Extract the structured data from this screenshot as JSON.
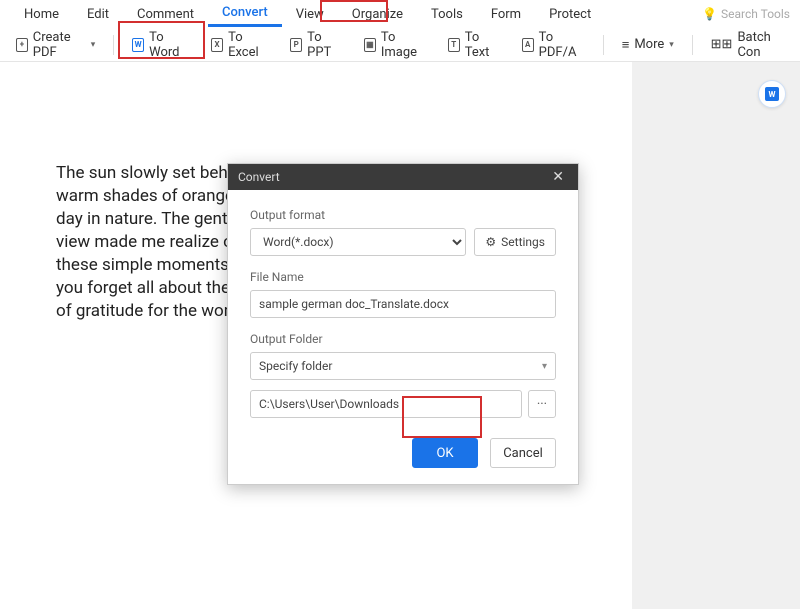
{
  "tabs": {
    "home": "Home",
    "edit": "Edit",
    "comment": "Comment",
    "convert": "Convert",
    "view": "View",
    "organize": "Organize",
    "tools": "Tools",
    "form": "Form",
    "protect": "Protect"
  },
  "search": {
    "placeholder": "Search Tools"
  },
  "toolbar": {
    "create": "Create PDF",
    "toWord": "To Word",
    "toExcel": "To Excel",
    "toPPT": "To PPT",
    "toImage": "To Image",
    "toText": "To Text",
    "toPDFA": "To PDF/A",
    "more": "More",
    "batch": "Batch Con"
  },
  "icons": {
    "plus": "+",
    "w": "W",
    "x": "X",
    "p": "P",
    "img": "▦",
    "t": "T",
    "a": "A"
  },
  "document": {
    "text": "The sun slowly set behind the mountains, and the sky turned into warm shades of orange and pink. It was the perfect conclusion to a day in nature. The gentle rustling of the leaves and the breathtaking view made me realize once again how important it is to appreciate these simple moments. The mountains emit a tranquility that makes you forget all about the stress of everyday life, and I felt a deep sense of gratitude for the wonders of nature."
  },
  "dialog": {
    "title": "Convert",
    "outputFormatLabel": "Output format",
    "outputFormatValue": "Word(*.docx)",
    "settingsLabel": "Settings",
    "fileNameLabel": "File Name",
    "fileNameValue": "sample german doc_Translate.docx",
    "outputFolderLabel": "Output Folder",
    "folderSelectValue": "Specify folder",
    "pathValue": "C:\\Users\\User\\Downloads",
    "ok": "OK",
    "cancel": "Cancel",
    "browseDots": "···"
  }
}
